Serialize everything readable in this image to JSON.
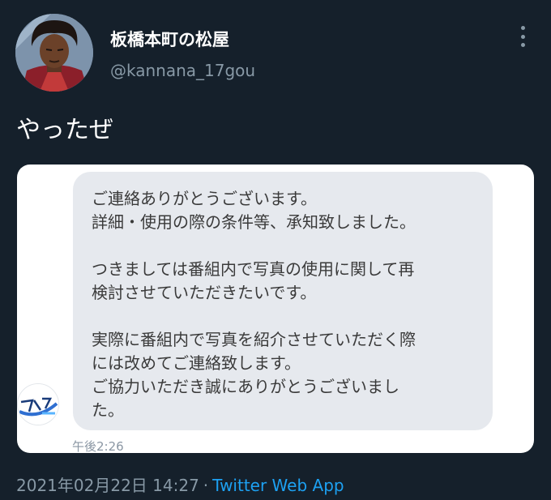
{
  "author": {
    "display_name": "板橋本町の松屋",
    "handle": "@kannana_17gou"
  },
  "tweet": {
    "text": "やったぜ"
  },
  "message": {
    "body": "ご連絡ありがとうございます。\n詳細・使用の際の条件等、承知致しました。\n\nつきましては番組内で写真の使用に関して再\n検討させていただきたいです。\n\n実際に番組内で写真を紹介させていただく際\nには改めてご連絡致します。\nご協力いただき誠にありがとうございまし\nた。",
    "time": "午後2:26"
  },
  "meta": {
    "timestamp": "2021年02月22日 14:27",
    "separator": "·",
    "source": "Twitter Web App"
  },
  "icons": {
    "more": "more-vertical-icon",
    "avatar": "profile-avatar",
    "sender_avatar": "sender-logo-avatar"
  },
  "colors": {
    "background": "#15202b",
    "secondary_text": "#8899a6",
    "link": "#1da1f2",
    "card": "#ffffff",
    "bubble": "#e6e9ee"
  }
}
